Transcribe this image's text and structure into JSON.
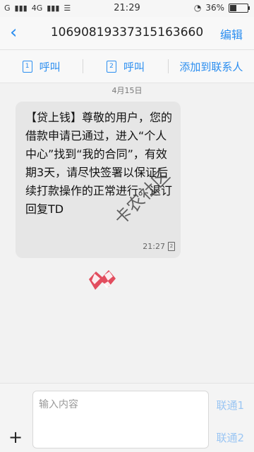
{
  "status": {
    "left": "G",
    "network": "4G",
    "time": "21:29",
    "battery_text": "36%",
    "battery_level": 0.36
  },
  "header": {
    "back_icon": "‹",
    "title": "10690819337315163660",
    "edit": "编辑"
  },
  "actions": {
    "call1": "呼叫",
    "call1_sim": "1",
    "call2": "呼叫",
    "call2_sim": "2",
    "add_contact": "添加到联系人"
  },
  "conversation": {
    "date": "4月15日",
    "message": {
      "text": "【贷上钱】尊敬的用户，您的借款申请已通过，进入“个人中心”找到“我的合同”，有效期3天，请尽快签署以保证后续打款操作的正常进行。退订回复TD",
      "time": "21:27",
      "sim": "2"
    }
  },
  "watermark": "卡农社区",
  "composer": {
    "plus": "+",
    "placeholder": "输入内容",
    "send1": "联通1",
    "send2": "联通2"
  }
}
